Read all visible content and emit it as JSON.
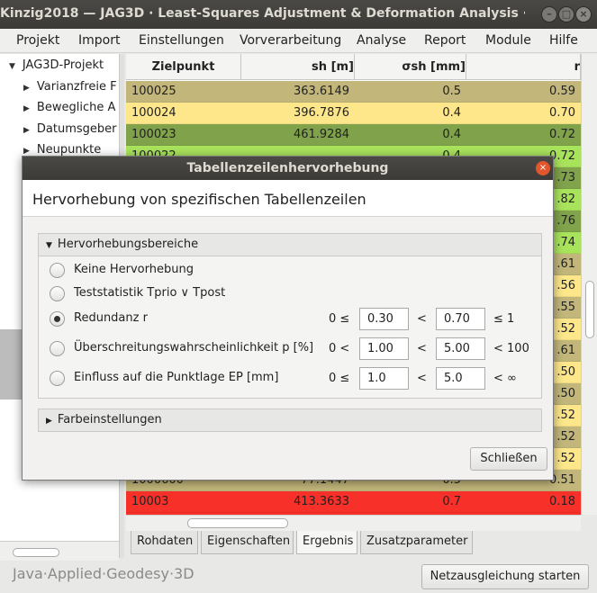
{
  "window": {
    "title": "Kinzig2018 — JAG3D · Least-Squares Adjustment & Deformation Analysis ·",
    "min_glyph": "–",
    "max_glyph": "□",
    "close_glyph": "×"
  },
  "menu": [
    "Projekt",
    "Import",
    "Einstellungen",
    "Vorverarbeitung",
    "Analyse",
    "Report",
    "Module",
    "Hilfe"
  ],
  "tree": {
    "root": "JAG3D-Projekt",
    "items": [
      "Varianzfreie F",
      "Bewegliche A",
      "Datumsgeber",
      "Neupunkte"
    ]
  },
  "table": {
    "columns": [
      "Zielpunkt",
      "sh [m]",
      "σsh [mm]",
      "r"
    ],
    "rows": [
      {
        "id": "100025",
        "sh": "363.6149",
        "ssh": "0.5",
        "r": "0.59",
        "color": "#c2b67a"
      },
      {
        "id": "100024",
        "sh": "396.7876",
        "ssh": "0.4",
        "r": "0.70",
        "color": "#fde78a"
      },
      {
        "id": "100023",
        "sh": "461.9284",
        "ssh": "0.4",
        "r": "0.72",
        "color": "#7fa24a"
      },
      {
        "id": "100022",
        "sh": "",
        "ssh": "0.4",
        "r": "0.72",
        "color": "#a9e35c"
      },
      {
        "id": "",
        "sh": "",
        "ssh": "",
        "r": ".73",
        "color": "#80a34c"
      },
      {
        "id": "",
        "sh": "",
        "ssh": "",
        "r": ".82",
        "color": "#a9e35c"
      },
      {
        "id": "",
        "sh": "",
        "ssh": "",
        "r": ".76",
        "color": "#80a34c"
      },
      {
        "id": "",
        "sh": "",
        "ssh": "",
        "r": ".74",
        "color": "#a9e35c"
      },
      {
        "id": "",
        "sh": "",
        "ssh": "",
        "r": ".61",
        "color": "#c2b67a"
      },
      {
        "id": "",
        "sh": "",
        "ssh": "",
        "r": ".56",
        "color": "#fde78a"
      },
      {
        "id": "",
        "sh": "",
        "ssh": "",
        "r": ".55",
        "color": "#c2b67a"
      },
      {
        "id": "",
        "sh": "",
        "ssh": "",
        "r": ".52",
        "color": "#fde78a"
      },
      {
        "id": "",
        "sh": "",
        "ssh": "",
        "r": ".61",
        "color": "#c2b67a"
      },
      {
        "id": "",
        "sh": "",
        "ssh": "",
        "r": ".50",
        "color": "#fde78a"
      },
      {
        "id": "",
        "sh": "",
        "ssh": "",
        "r": ".50",
        "color": "#c2b67a"
      },
      {
        "id": "",
        "sh": "",
        "ssh": "",
        "r": ".52",
        "color": "#fde78a"
      },
      {
        "id": "",
        "sh": "",
        "ssh": "",
        "r": ".52",
        "color": "#c2b67a"
      },
      {
        "id": "",
        "sh": "",
        "ssh": "",
        "r": ".52",
        "color": "#fde78a"
      },
      {
        "id": "1000600",
        "sh": "77.1447",
        "ssh": "0.5",
        "r": "0.51",
        "color": "#c2b67a"
      },
      {
        "id": "10003",
        "sh": "413.3633",
        "ssh": "0.7",
        "r": "0.18",
        "color": "#f7302a"
      },
      {
        "id": "",
        "sh": "",
        "ssh": "",
        "r": "",
        "color": "#f7302a"
      }
    ]
  },
  "tabs": [
    "Rohdaten",
    "Eigenschaften",
    "Ergebnis",
    "Zusatzparameter"
  ],
  "active_tab": "Ergebnis",
  "footer": {
    "brand": "Java·Applied·Geodesy·3D",
    "start_button": "Netzausgleichung starten"
  },
  "dialog": {
    "title": "Tabellenzeilenhervorhebung",
    "close_glyph": "×",
    "header": "Hervorhebung von spezifischen Tabellenzeilen",
    "section1": "Hervorhebungsbereiche",
    "section2": "Farbeinstellungen",
    "options": [
      {
        "label": "Keine Hervorhebung",
        "selected": false
      },
      {
        "label": "Teststatistik Tprio ∨ Tpost",
        "selected": false
      },
      {
        "label": "Redundanz r",
        "selected": true,
        "lower_op": "0 ≤",
        "low": "0.30",
        "mid_op": "<",
        "high": "0.70",
        "upper_op": "≤ 1"
      },
      {
        "label": "Überschreitungswahrscheinlichkeit p [%]",
        "selected": false,
        "lower_op": "0 <",
        "low": "1.00",
        "mid_op": "<",
        "high": "5.00",
        "upper_op": "< 100"
      },
      {
        "label": "Einfluss auf die Punktlage EP [mm]",
        "selected": false,
        "lower_op": "0 ≤",
        "low": "1.0",
        "mid_op": "<",
        "high": "5.0",
        "upper_op": "< ∞"
      }
    ],
    "close_button": "Schließen"
  }
}
